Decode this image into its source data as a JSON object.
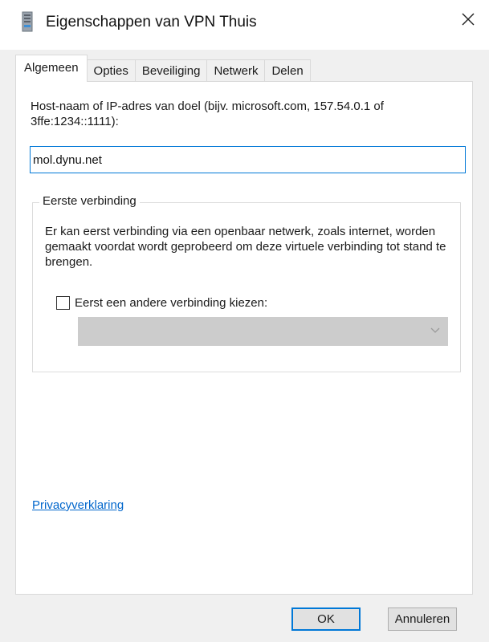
{
  "window": {
    "title": "Eigenschappen van VPN Thuis"
  },
  "tabs": [
    {
      "label": "Algemeen",
      "active": true
    },
    {
      "label": "Opties",
      "active": false
    },
    {
      "label": "Beveiliging",
      "active": false
    },
    {
      "label": "Netwerk",
      "active": false
    },
    {
      "label": "Delen",
      "active": false
    }
  ],
  "general": {
    "host_label": "Host-naam of IP-adres van doel (bijv. microsoft.com, 157.54.0.1 of 3ffe:1234::1111):",
    "host_value": "mol.dynu.net",
    "first_connection": {
      "title": "Eerste verbinding",
      "description": "Er kan eerst verbinding via een openbaar netwerk, zoals internet, worden gemaakt voordat wordt geprobeerd om deze virtuele verbinding tot stand te brengen.",
      "checkbox_label": "Eerst een andere verbinding kiezen:",
      "checkbox_checked": false,
      "select_value": "",
      "select_disabled": true
    },
    "privacy_link": "Privacyverklaring"
  },
  "buttons": {
    "ok": "OK",
    "cancel": "Annuleren"
  },
  "icons": {
    "app": "vpn-network-icon",
    "close": "close-icon",
    "dropdown": "chevron-down-icon"
  },
  "colors": {
    "accent": "#0078d7",
    "link": "#0066cc",
    "dialog_bg": "#f0f0f0",
    "panel_bg": "#ffffff"
  }
}
